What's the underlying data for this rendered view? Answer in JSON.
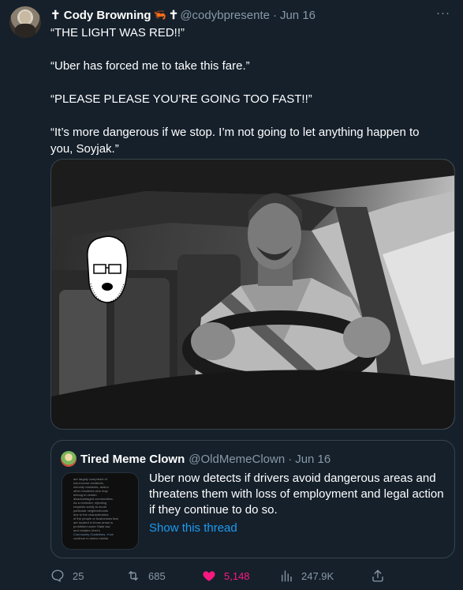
{
  "tweet": {
    "author": {
      "name": "✝ Cody Browning",
      "emoji": "🦐",
      "cross": "✝",
      "handle": "@codybpresente",
      "date": "Jun 16"
    },
    "more_label": "···",
    "text": [
      "“THE LIGHT WAS RED!!”",
      "“Uber has forced me to take this fare.”",
      "“PLEASE PLEASE YOU’RE GOING TOO FAST!!”",
      "“It’s more dangerous if we stop. I’m not going to let anything happen to you, Soyjak.”"
    ],
    "media": {
      "icon": "photo"
    },
    "quoted": {
      "name": "Tired Meme Clown",
      "handle": "@OldMemeClown",
      "date": "Jun 16",
      "text": "Uber now detects if drivers avoid dangerous areas and threatens them with loss of employment and legal action if they continue to do so.",
      "link": "Show this thread",
      "thumbnail_lines": [
        "are largely comprised of",
        "low-income residents,",
        "minority residents, and/or",
        "other residents who may",
        "belong to certain",
        "disadvantaged communities.",
        "As a reminder, rejecting",
        "requests solely to avoid",
        "particular neighborhoods",
        "due to the characteristics",
        "of the people or businesses that",
        "are located in those areas is",
        "prohibited under State law",
        "and violates Uber's",
        "Community Guidelines. If we",
        "continue to detect similar"
      ]
    },
    "stats": {
      "replies": "25",
      "retweets": "685",
      "likes": "5,148",
      "views": "247.9K"
    },
    "colors": {
      "background": "#15202b",
      "muted": "#8899a6",
      "link": "#1d9bf0",
      "like": "#f91880",
      "border": "#38444d"
    }
  }
}
